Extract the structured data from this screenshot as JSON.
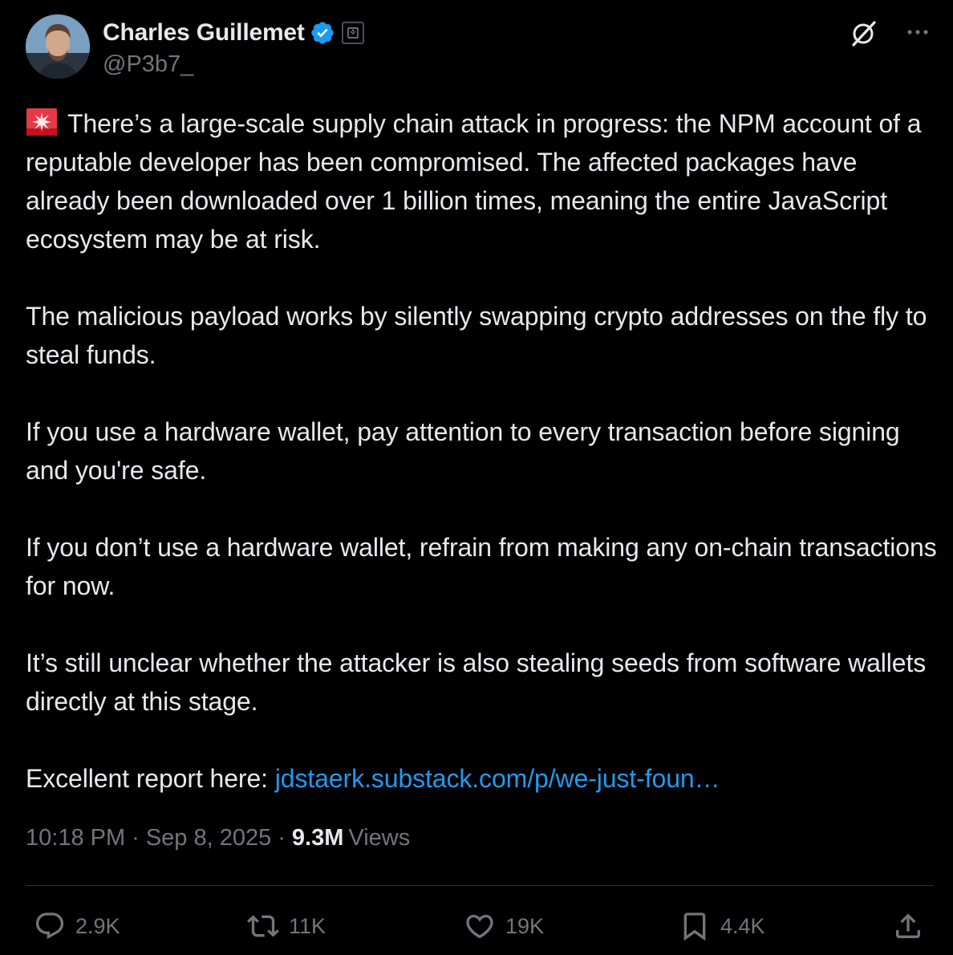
{
  "author": {
    "name": "Charles Guillemet",
    "handle": "@P3b7_",
    "verified": true,
    "avatar_icon": "avatar-photo"
  },
  "colors": {
    "background": "#000000",
    "text": "#e7e9ea",
    "secondary": "#71767b",
    "link": "#1d9bf0",
    "verified": "#1d9bf0",
    "divider": "#2f3336"
  },
  "tweet": {
    "emoji": "🚨",
    "paragraphs": [
      "There’s a large-scale supply chain attack in progress: the NPM account of a reputable developer has been compromised. The affected packages have already been downloaded over 1 billion times, meaning the entire JavaScript ecosystem may be at risk.",
      "The malicious payload works by silently swapping crypto addresses on the fly to steal funds.",
      "If you use a hardware wallet, pay attention to every transaction before signing and you're safe.",
      "If you don’t use a hardware wallet, refrain from making any on-chain transactions for now.",
      "It’s still unclear whether the attacker is also stealing seeds from software wallets directly at this stage."
    ],
    "report_prefix": "Excellent report here: ",
    "report_link": "jdstaerk.substack.com/p/we-just-foun…"
  },
  "meta": {
    "time": "10:18 PM",
    "separator": "·",
    "date": "Sep 8, 2025",
    "views_count": "9.3M",
    "views_label": "Views"
  },
  "actions": {
    "replies": "2.9K",
    "reposts": "11K",
    "likes": "19K",
    "bookmarks": "4.4K"
  }
}
